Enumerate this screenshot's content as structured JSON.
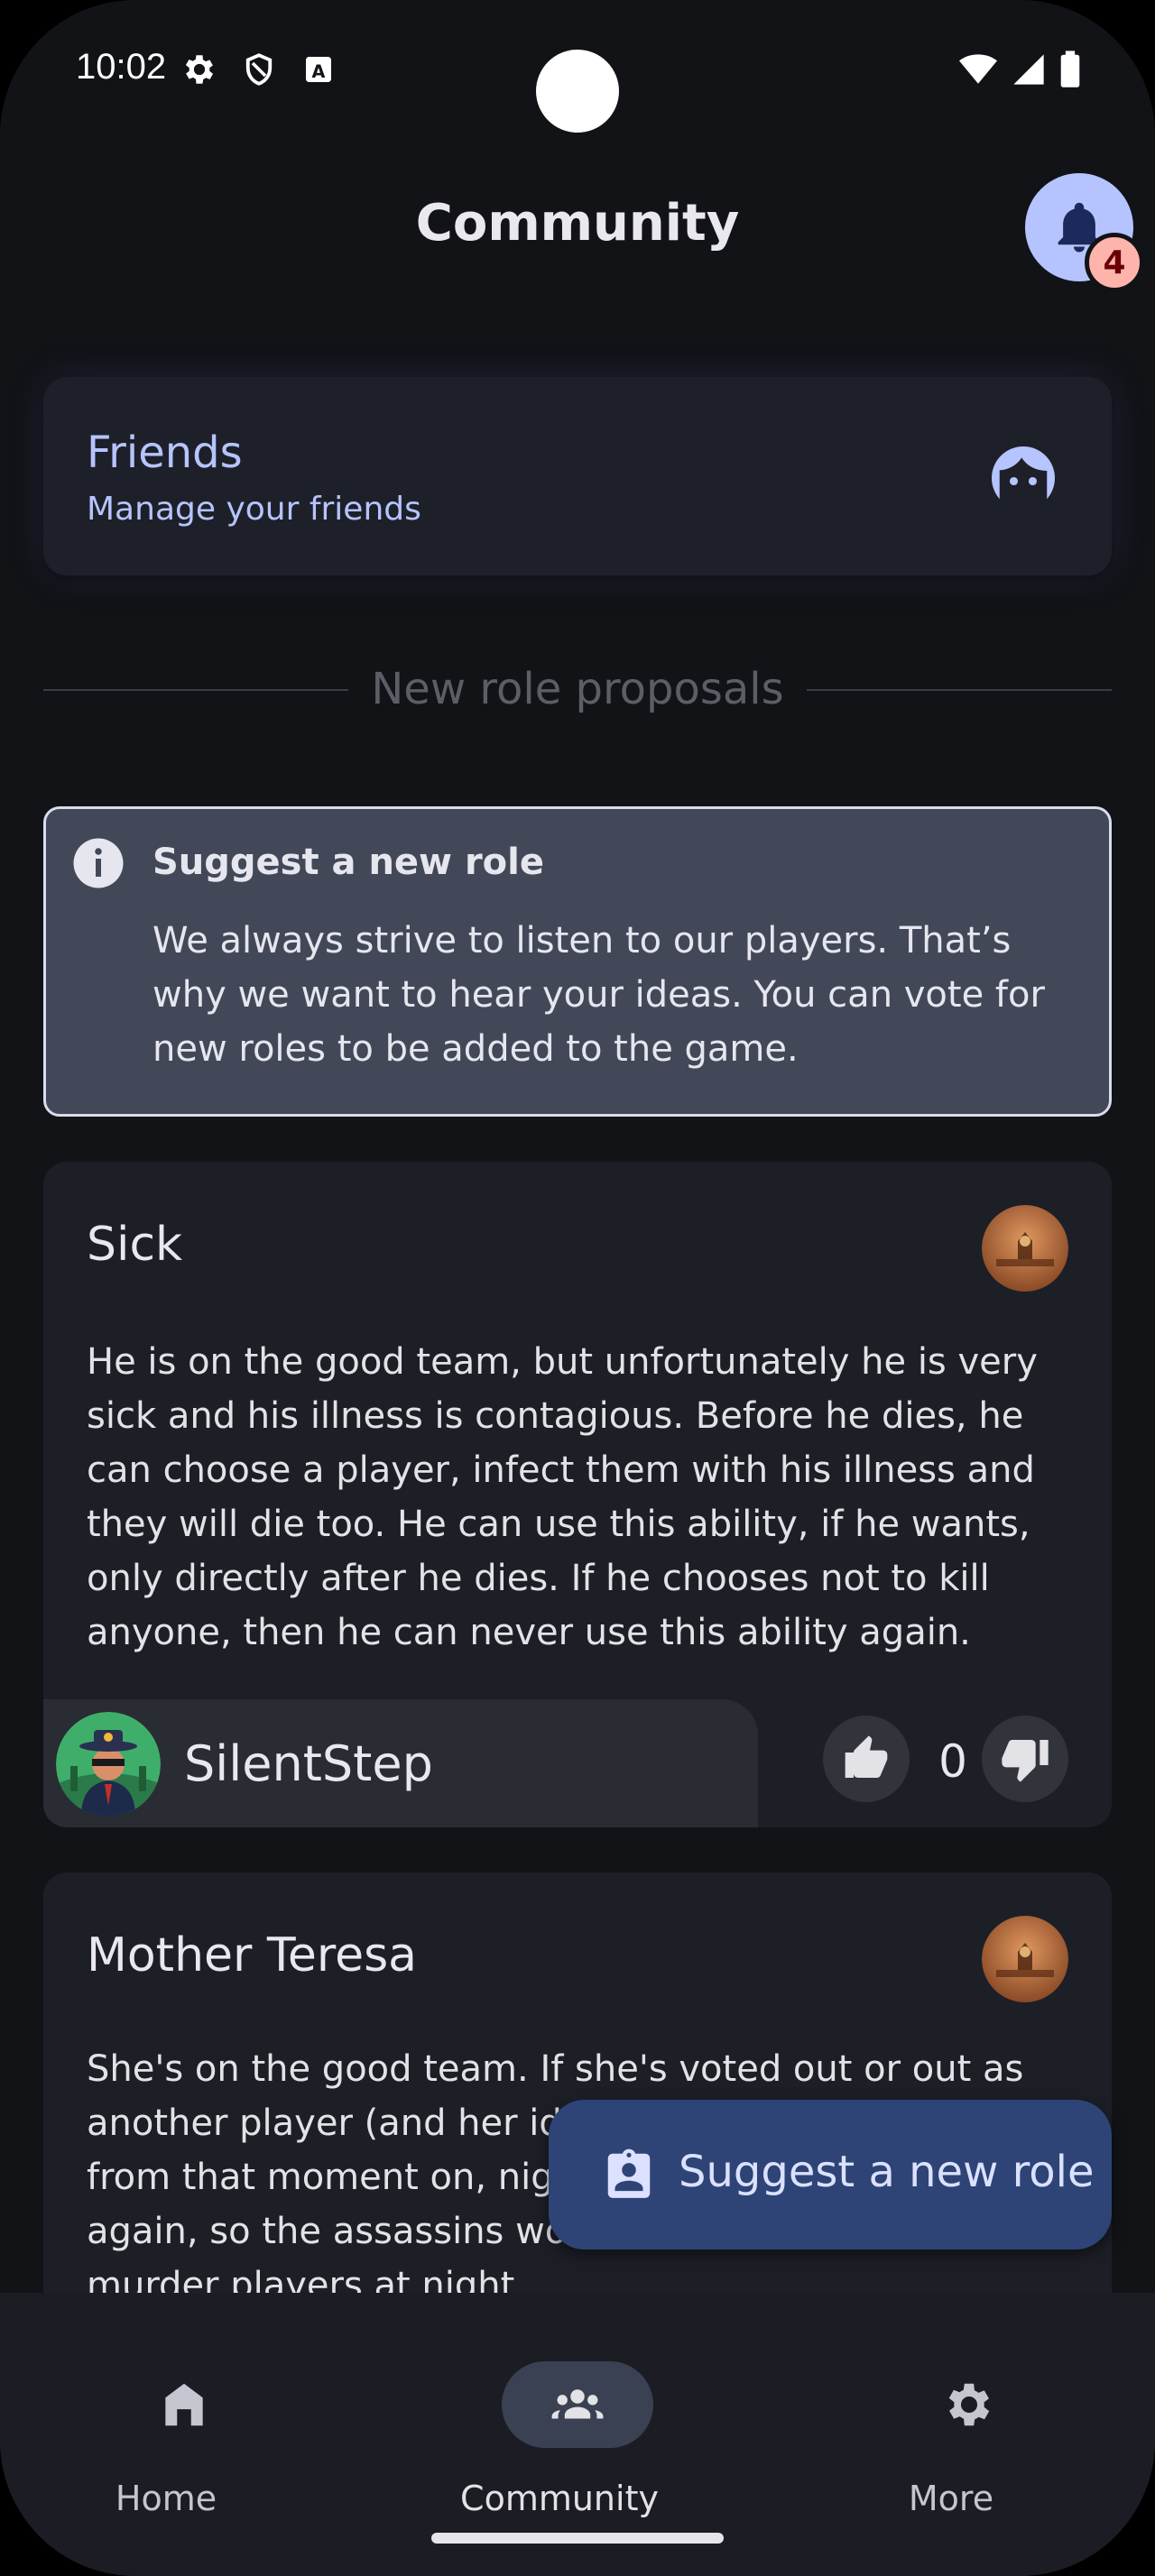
{
  "status_bar": {
    "time": "10:02"
  },
  "header": {
    "title": "Community",
    "notification_count": "4"
  },
  "friends_card": {
    "title": "Friends",
    "subtitle": "Manage your friends"
  },
  "section_divider": "New role proposals",
  "info_box": {
    "title": "Suggest a new role",
    "body": "We always strive to listen to our players. That’s why we want to hear your ideas. You can vote for new roles to be added to the game."
  },
  "proposals": [
    {
      "name": "Sick",
      "description": "He is on the good team, but unfortunately he is very sick and his illness is contagious. Before he dies, he can choose a player, infect them with his illness and they will die too. He can use this ability, if he wants, only directly after he dies. If he chooses not to kill anyone, then he can never use this ability again.",
      "author": "SilentStep",
      "votes": "0"
    },
    {
      "name": "Mother Teresa",
      "description": "She's on the good team. If she's voted out or out as another player (and her identity is revealed), from that moment on, nights don't happen again, so the assassins won't have the opportunity to murder players at night.",
      "description_lines": [
        "She's on the good team. If she's voted out or out as",
        "another player (and her id",
        "from that moment on, nig",
        "again, so the assassins wo",
        "murder players at night."
      ]
    }
  ],
  "fab": {
    "label": "Suggest a new role"
  },
  "bottom_nav": [
    {
      "label": "Home",
      "icon": "home-icon",
      "active": false
    },
    {
      "label": "Community",
      "icon": "groups-icon",
      "active": true
    },
    {
      "label": "More",
      "icon": "gear-icon",
      "active": false
    }
  ],
  "colors": {
    "background": "#121317",
    "card": "#1d1f27",
    "accent": "#b5c4ff",
    "fab": "#2e4476",
    "badge": "#ffb4ab"
  }
}
